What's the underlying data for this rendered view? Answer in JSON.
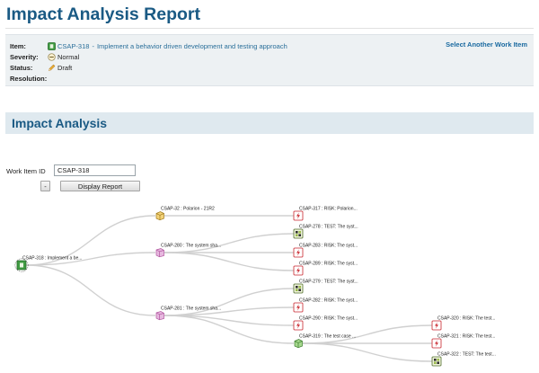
{
  "page_title": "Impact Analysis Report",
  "item_panel": {
    "item_label": "Item:",
    "item_id": "CSAP-318",
    "item_separator": "-",
    "item_title": "Implement a behavior driven development and testing approach",
    "severity_label": "Severity:",
    "severity_value": "Normal",
    "status_label": "Status:",
    "status_value": "Draft",
    "resolution_label": "Resolution:",
    "resolution_value": "",
    "select_link": "Select Another Work Item"
  },
  "section_title": "Impact Analysis",
  "form": {
    "work_item_label": "Work Item ID",
    "work_item_value": "CSAP-318",
    "collapse_label": "-",
    "display_button": "Display Report"
  },
  "graph": {
    "colors": {
      "edge": "#d0d0d0",
      "risk": "#c9252c",
      "test": "#4f6b2a",
      "requirement": "#b0549e",
      "feature": "#d9a92c",
      "story": "#3f9b42"
    },
    "nodes": [
      {
        "id": "n318",
        "label": "CSAP-318 : Implement a be...",
        "icon": "story-icon",
        "kind": "root"
      },
      {
        "id": "n32",
        "label": "CSAP-32 : Polarion - 21R2",
        "icon": "feature-icon",
        "kind": "feature",
        "parent": "n318"
      },
      {
        "id": "n280",
        "label": "CSAP-280 : The system sha...",
        "icon": "requirement-icon",
        "kind": "requirement",
        "parent": "n318"
      },
      {
        "id": "n281",
        "label": "CSAP-281 : The system sha...",
        "icon": "requirement-icon",
        "kind": "requirement",
        "parent": "n318"
      },
      {
        "id": "n317",
        "label": "CSAP-317 : RISK: Polarion...",
        "icon": "risk-icon",
        "kind": "risk",
        "parent": "n32"
      },
      {
        "id": "n278",
        "label": "CSAP-278 : TEST: The syst...",
        "icon": "test-icon",
        "kind": "test",
        "parent": "n280"
      },
      {
        "id": "n283",
        "label": "CSAP-283 : RISK: The syst...",
        "icon": "risk-icon",
        "kind": "risk",
        "parent": "n280"
      },
      {
        "id": "n289",
        "label": "CSAP-289 : RISK: The syst...",
        "icon": "risk-icon",
        "kind": "risk",
        "parent": "n280"
      },
      {
        "id": "n279",
        "label": "CSAP-279 : TEST: The syst...",
        "icon": "test-icon",
        "kind": "test",
        "parent": "n281"
      },
      {
        "id": "n282",
        "label": "CSAP-282 : RISK: The syst...",
        "icon": "risk-icon",
        "kind": "risk",
        "parent": "n281"
      },
      {
        "id": "n290",
        "label": "CSAP-290 : RISK: The syst...",
        "icon": "risk-icon",
        "kind": "risk",
        "parent": "n281"
      },
      {
        "id": "n319",
        "label": "CSAP-319 : The test case ...",
        "icon": "testcase-icon",
        "kind": "story",
        "parent": "n281"
      },
      {
        "id": "n320",
        "label": "CSAP-320 : RISK: The test...",
        "icon": "risk-icon",
        "kind": "risk",
        "parent": "n319"
      },
      {
        "id": "n321",
        "label": "CSAP-321 : RISK: The test...",
        "icon": "risk-icon",
        "kind": "risk",
        "parent": "n319"
      },
      {
        "id": "n322",
        "label": "CSAP-322 : TEST: The test...",
        "icon": "test-icon",
        "kind": "test",
        "parent": "n319"
      }
    ]
  }
}
